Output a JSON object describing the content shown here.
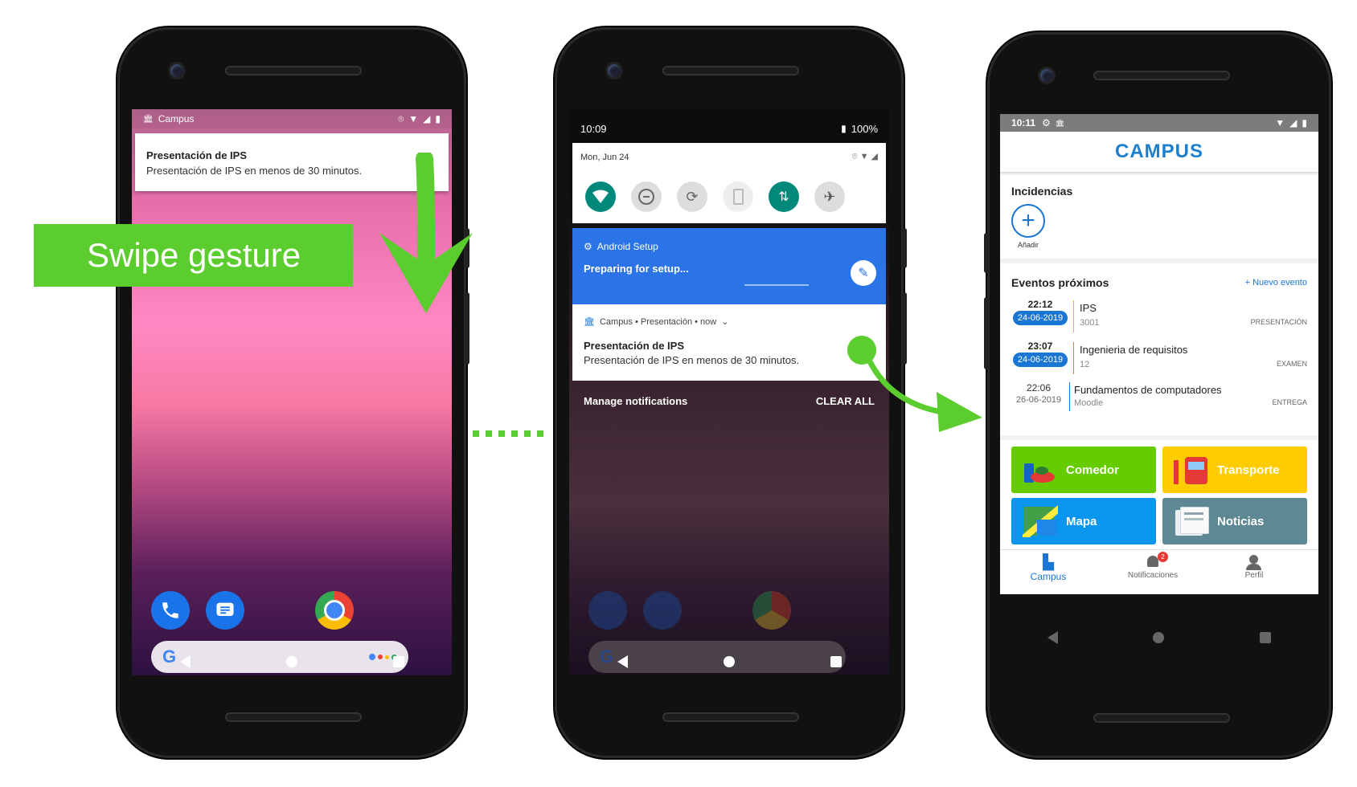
{
  "phone1": {
    "status_app": "Campus",
    "notif_title": "Presentación de IPS",
    "notif_text": "Presentación de IPS en menos de 30 minutos.",
    "swipe_label": "Swipe gesture"
  },
  "phone2": {
    "time": "10:09",
    "battery": "100%",
    "date": "Mon, Jun 24",
    "setup_header": "Android Setup",
    "setup_text": "Preparing for setup...",
    "campus_header": "Campus • Presentación • now",
    "notif_title": "Presentación de IPS",
    "notif_text": "Presentación de IPS en menos de 30 minutos.",
    "manage": "Manage notifications",
    "clear_all": "CLEAR ALL"
  },
  "phone3": {
    "time": "10:11",
    "logo": "CAMPUS",
    "incidencias_title": "Incidencias",
    "add_label": "Añadir",
    "eventos_title": "Eventos próximos",
    "nuevo_evento": "+ Nuevo evento",
    "events": [
      {
        "time": "22:12",
        "date": "24-06-2019",
        "title": "IPS",
        "sub": "3001",
        "tag": "PRESENTACIÓN"
      },
      {
        "time": "23:07",
        "date": "24-06-2019",
        "title": "Ingenieria de requisitos",
        "sub": "12",
        "tag": "EXAMEN"
      },
      {
        "time": "22:06",
        "date": "26-06-2019",
        "title": "Fundamentos de computadores",
        "sub": "Moodle",
        "tag": "ENTREGA"
      }
    ],
    "tiles": [
      {
        "label": "Comedor",
        "color": "#66cc00"
      },
      {
        "label": "Transporte",
        "color": "#ffcc00"
      },
      {
        "label": "Mapa",
        "color": "#0a96ee"
      },
      {
        "label": "Noticias",
        "color": "#5f8895"
      }
    ],
    "bottom_nav": {
      "campus": "Campus",
      "notificaciones": "Notificaciones",
      "perfil": "Perfil",
      "badge": "2"
    }
  },
  "colors": {
    "accent_green": "#5ccd2e",
    "campus_blue": "#1976d2",
    "setup_blue": "#2b74e8",
    "teal": "#00897b"
  }
}
